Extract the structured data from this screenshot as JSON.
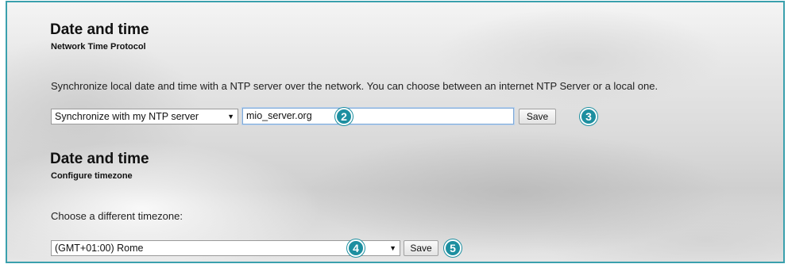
{
  "ntp_section": {
    "title": "Date and time",
    "subtitle": "Network Time Protocol",
    "description": "Synchronize local date and time with a NTP server over the network. You can choose between an internet NTP Server or a local one.",
    "mode_select": {
      "selected": "Synchronize with my NTP server"
    },
    "server_input": {
      "value": "mio_server.org"
    },
    "save_label": "Save"
  },
  "timezone_section": {
    "title": "Date and time",
    "subtitle": "Configure timezone",
    "description": "Choose a different timezone:",
    "timezone_select": {
      "selected": "(GMT+01:00) Rome"
    },
    "save_label": "Save"
  },
  "callouts": {
    "badge_2": "2",
    "badge_3": "3",
    "badge_4": "4",
    "badge_5": "5"
  },
  "colors": {
    "frame_border": "#3aa0ad",
    "badge": "#1d8fa0"
  },
  "icons": {
    "dropdown": "chevron-down-icon"
  }
}
